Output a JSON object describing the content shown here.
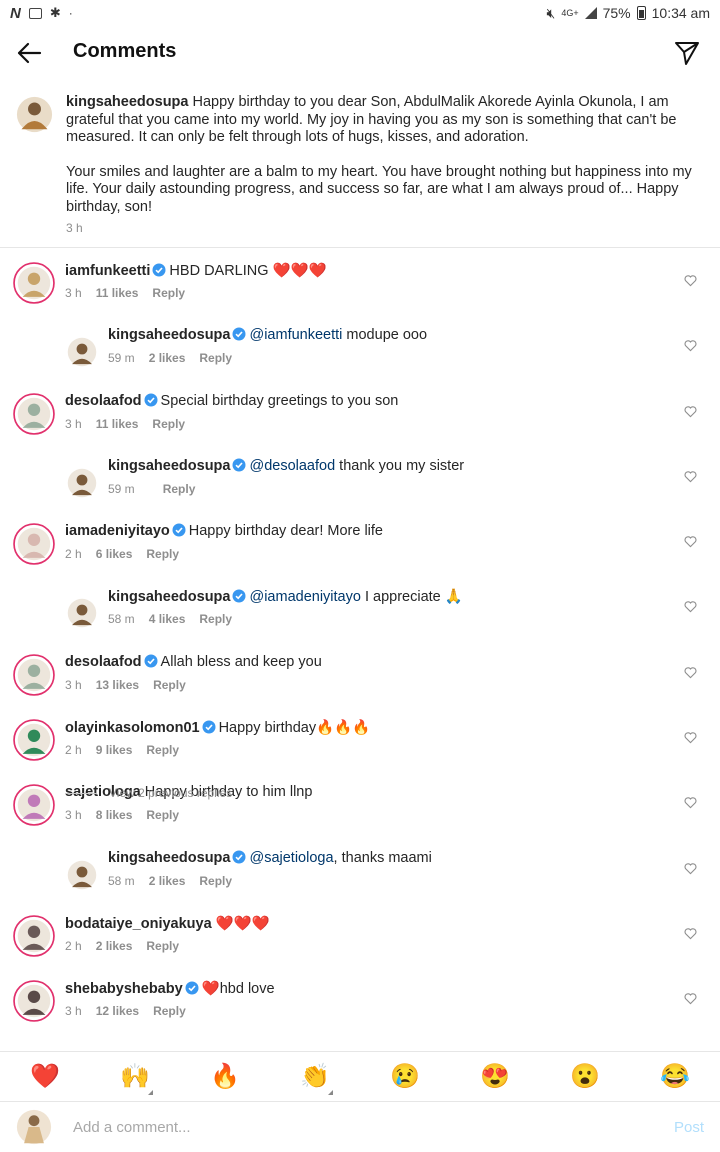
{
  "status_bar": {
    "left_icons": [
      "netflix-icon",
      "gallery-icon",
      "android-icon"
    ],
    "net": "4G+",
    "battery": "75%",
    "time": "10:34 am"
  },
  "header": {
    "title": "Comments"
  },
  "caption": {
    "username": "kingsaheedosupa",
    "paragraph1": "Happy birthday to you dear Son, AbdulMalik Akorede Ayinla Okunola, I am grateful that you came into my world. My joy in having you as my son is something that can't be measured. It can only be felt through lots of hugs, kisses, and adoration.",
    "paragraph2": "Your smiles and laughter are a balm to my heart. You have brought nothing but happiness into my life. Your daily astounding progress, and success so far, are what I am always proud of... Happy birthday, son!",
    "time": "3 h"
  },
  "comments": [
    {
      "username": "iamfunkeetti",
      "verified": true,
      "mention": "",
      "text": "HBD DARLING ❤️❤️❤️",
      "time": "3 h",
      "likes": "11 likes",
      "reply": "Reply",
      "is_reply": false,
      "avatar_color": "#c8a46a"
    },
    {
      "username": "kingsaheedosupa",
      "verified": true,
      "mention": "@iamfunkeetti",
      "text": " modupe ooo",
      "time": "59 m",
      "likes": "2 likes",
      "reply": "Reply",
      "is_reply": true,
      "avatar_color": "#7a5a3a"
    },
    {
      "username": "desolaafod",
      "verified": true,
      "mention": "",
      "text": "Special birthday greetings to you son",
      "time": "3 h",
      "likes": "11 likes",
      "reply": "Reply",
      "is_reply": false,
      "avatar_color": "#9cb0a0"
    },
    {
      "username": "kingsaheedosupa",
      "verified": true,
      "mention": "@desolaafod",
      "text": " thank you my sister",
      "time": "59 m",
      "likes": "",
      "reply": "Reply",
      "is_reply": true,
      "avatar_color": "#7a5a3a"
    },
    {
      "username": "iamadeniyitayo",
      "verified": true,
      "mention": "",
      "text": "Happy birthday dear! More life",
      "time": "2 h",
      "likes": "6 likes",
      "reply": "Reply",
      "is_reply": false,
      "avatar_color": "#d8b8b0"
    },
    {
      "username": "kingsaheedosupa",
      "verified": true,
      "mention": "@iamadeniyitayo",
      "text": " I appreciate 🙏",
      "time": "58 m",
      "likes": "4 likes",
      "reply": "Reply",
      "is_reply": true,
      "avatar_color": "#7a5a3a"
    },
    {
      "username": "desolaafod",
      "verified": true,
      "mention": "",
      "text": "Allah bless and keep you",
      "time": "3 h",
      "likes": "13 likes",
      "reply": "Reply",
      "is_reply": false,
      "avatar_color": "#9cb0a0"
    },
    {
      "username": "olayinkasolomon01",
      "verified": true,
      "mention": "",
      "text": "Happy birthday🔥🔥🔥",
      "time": "2 h",
      "likes": "9 likes",
      "reply": "Reply",
      "is_reply": false,
      "avatar_color": "#2f8a5a"
    },
    {
      "username": "sajetiologa",
      "verified": false,
      "mention": "",
      "text": "Happy birthday to him llnp",
      "time": "3 h",
      "likes": "8 likes",
      "reply": "Reply",
      "is_reply": false,
      "avatar_color": "#c07ab8"
    },
    {
      "username": "kingsaheedosupa",
      "verified": true,
      "mention": "@sajetiologa",
      "text": ",  thanks maami",
      "time": "58 m",
      "likes": "2 likes",
      "reply": "Reply",
      "is_reply": true,
      "avatar_color": "#7a5a3a"
    },
    {
      "username": "bodataiye_oniyakuya",
      "verified": false,
      "mention": "",
      "text": "❤️❤️❤️",
      "time": "2 h",
      "likes": "2 likes",
      "reply": "Reply",
      "is_reply": false,
      "avatar_color": "#6a5a58"
    },
    {
      "username": "shebabyshebaby",
      "verified": true,
      "mention": "",
      "text": "❤️hbd love",
      "time": "3 h",
      "likes": "12 likes",
      "reply": "Reply",
      "is_reply": false,
      "avatar_color": "#5a4a48"
    }
  ],
  "view_previous": "View 2 previous replies",
  "emoji_bar": [
    "❤️",
    "🙌",
    "🔥",
    "👏",
    "😢",
    "😍",
    "😮",
    "😂"
  ],
  "input": {
    "placeholder": "Add a comment...",
    "post_label": "Post"
  },
  "colors": {
    "link": "#00376b",
    "verified": "#3897f0",
    "post_disabled": "#b2dffc",
    "story_ring": "#e1306c"
  }
}
